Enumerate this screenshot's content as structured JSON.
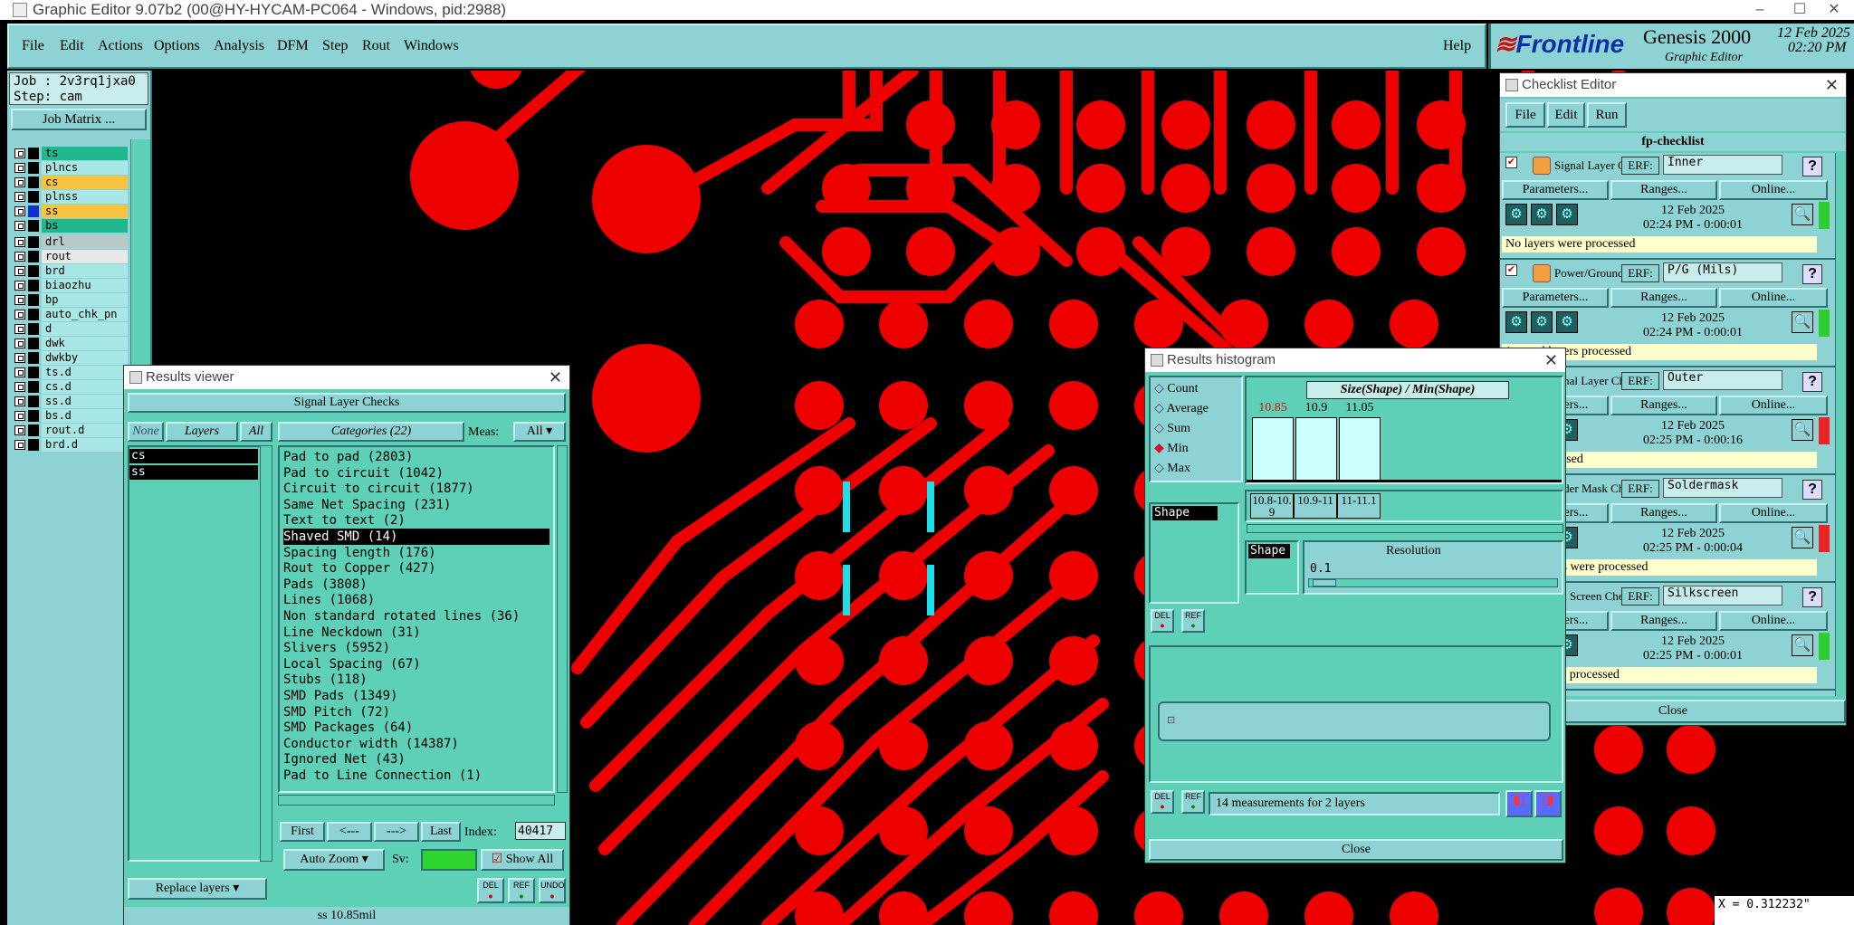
{
  "app": {
    "title": "Graphic Editor 9.07b2 (00@HY-HYCAM-PC064 - Windows, pid:2988)",
    "window_controls": [
      "–",
      "☐",
      "✕"
    ]
  },
  "menu": {
    "items": [
      "File",
      "Edit",
      "Actions",
      "Options",
      "Analysis",
      "DFM",
      "Step",
      "Rout",
      "Windows"
    ],
    "help": "Help"
  },
  "brand": {
    "logo": "Frontline",
    "product": "Genesis 2000",
    "subtitle": "Graphic Editor",
    "date": "12 Feb 2025",
    "time": "02:20 PM"
  },
  "job": {
    "job_line": "Job : 2v3rq1jxa0",
    "step_line": "Step: cam",
    "matrix_button": "Job Matrix ..."
  },
  "layers": [
    {
      "name": "ts",
      "color": "#1fb88e"
    },
    {
      "name": "plncs",
      "color": "#a9e6e6"
    },
    {
      "name": "cs",
      "color": "#f7c440"
    },
    {
      "name": "plnss",
      "color": "#a9e6e6"
    },
    {
      "name": "ss",
      "color": "#f7c440"
    },
    {
      "name": "bs",
      "color": "#1fb88e"
    },
    {
      "name": "drl",
      "color": "#b7c9c9"
    },
    {
      "name": "rout",
      "color": "#e8e8e8"
    },
    {
      "name": "brd",
      "color": "#a9e6e6"
    },
    {
      "name": "biaozhu",
      "color": "#a9e6e6"
    },
    {
      "name": "bp",
      "color": "#a9e6e6"
    },
    {
      "name": "auto_chk_pn",
      "color": "#a9e6e6"
    },
    {
      "name": "d",
      "color": "#a9e6e6"
    },
    {
      "name": "dwk",
      "color": "#a9e6e6"
    },
    {
      "name": "dwkby",
      "color": "#a9e6e6"
    },
    {
      "name": "ts.d",
      "color": "#a9e6e6"
    },
    {
      "name": "cs.d",
      "color": "#a9e6e6"
    },
    {
      "name": "ss.d",
      "color": "#a9e6e6"
    },
    {
      "name": "bs.d",
      "color": "#a9e6e6"
    },
    {
      "name": "rout.d",
      "color": "#a9e6e6"
    },
    {
      "name": "brd.d",
      "color": "#a9e6e6"
    }
  ],
  "results_viewer": {
    "title": "Results viewer",
    "header": "Signal Layer Checks",
    "none_btn": "None",
    "layers_btn": "Layers",
    "all_btn": "All",
    "categories_label": "Categories (22)",
    "meas_label": "Meas:",
    "meas_value": "All",
    "layer_list": [
      "cs",
      "ss"
    ],
    "categories": [
      "Pad to pad (2803)",
      "Pad to circuit (1042)",
      "Circuit to circuit (1877)",
      "Same Net Spacing (231)",
      "Text to text (2)",
      "Shaved SMD (14)",
      "Spacing length (176)",
      "Rout to Copper (427)",
      "Pads (3808)",
      "Lines (1068)",
      "Non standard rotated lines (36)",
      "Line Neckdown (31)",
      "Slivers (5952)",
      "Local Spacing (67)",
      "Stubs (118)",
      "SMD Pads (1349)",
      "SMD Pitch (72)",
      "SMD Packages (64)",
      "Conductor width (14387)",
      "Ignored Net (43)",
      "Pad to Line Connection (1)"
    ],
    "first_btn": "First",
    "prev_btn": "<---",
    "next_btn": "--->",
    "last_btn": "Last",
    "index_label": "Index:",
    "index_value": "40417",
    "autozoom": "Auto Zoom",
    "sv_label": "Sv:",
    "show_all": "Show All",
    "replace_layers": "Replace layers",
    "status": "ss 10.85mil",
    "del": "DEL",
    "ref": "REF",
    "undo": "UNDO"
  },
  "histogram": {
    "title": "Results histogram",
    "modes": [
      "Count",
      "Average",
      "Sum",
      "Min",
      "Max"
    ],
    "selected_mode": "Min",
    "chart_title": "Size(Shape) / Min(Shape)",
    "bars": [
      {
        "label": "10.85",
        "bin": "10.8-10.9",
        "highlight": true
      },
      {
        "label": "10.9",
        "bin": "10.9-11",
        "highlight": false
      },
      {
        "label": "11.05",
        "bin": "11-11.1",
        "highlight": false
      }
    ],
    "attr_item": "Shape",
    "shape_tag": "Shape",
    "resolution_label": "Resolution",
    "resolution_value": "0.1",
    "summary": "14 measurements for 2 layers",
    "close": "Close",
    "del": "DEL",
    "ref": "REF"
  },
  "checklist": {
    "title": "Checklist Editor",
    "menu": [
      "File",
      "Edit",
      "Run"
    ],
    "name": "fp-checklist",
    "params_btn": "Parameters...",
    "ranges_btn": "Ranges...",
    "online_btn": "Online...",
    "erf_label": "ERF:",
    "help_q": "?",
    "close": "Close",
    "items": [
      {
        "name": "Signal Layer Ch",
        "erf": "Inner",
        "date": "12 Feb 2025",
        "time": "02:24 PM - 0:00:01",
        "message": "No layers were processed",
        "status_color": "#2ecc2e"
      },
      {
        "name": "Power/Ground C",
        "erf": "P/G (Mils)",
        "date": "12 Feb 2025",
        "time": "02:24 PM - 0:00:01",
        "message": "/ground layers processed",
        "status_color": "#2ecc2e"
      },
      {
        "name": "ignal Layer Ch",
        "erf": "Outer",
        "date": "12 Feb 2025",
        "time": "02:25 PM - 0:00:16",
        "message": "were processed",
        "status_color": "#ee2222"
      },
      {
        "name": "older Mask Ch",
        "erf": "Soldermask",
        "date": "12 Feb 2025",
        "time": "02:25 PM - 0:00:04",
        "message": "Mask layers were processed",
        "status_color": "#ee2222"
      },
      {
        "name": "ilk Screen Che",
        "erf": "Silkscreen",
        "date": "12 Feb 2025",
        "time": "02:25 PM - 0:00:01",
        "message": "creen layers processed",
        "status_color": "#2ecc2e"
      }
    ]
  },
  "coords": {
    "x_line": "X = 0.312232\""
  }
}
